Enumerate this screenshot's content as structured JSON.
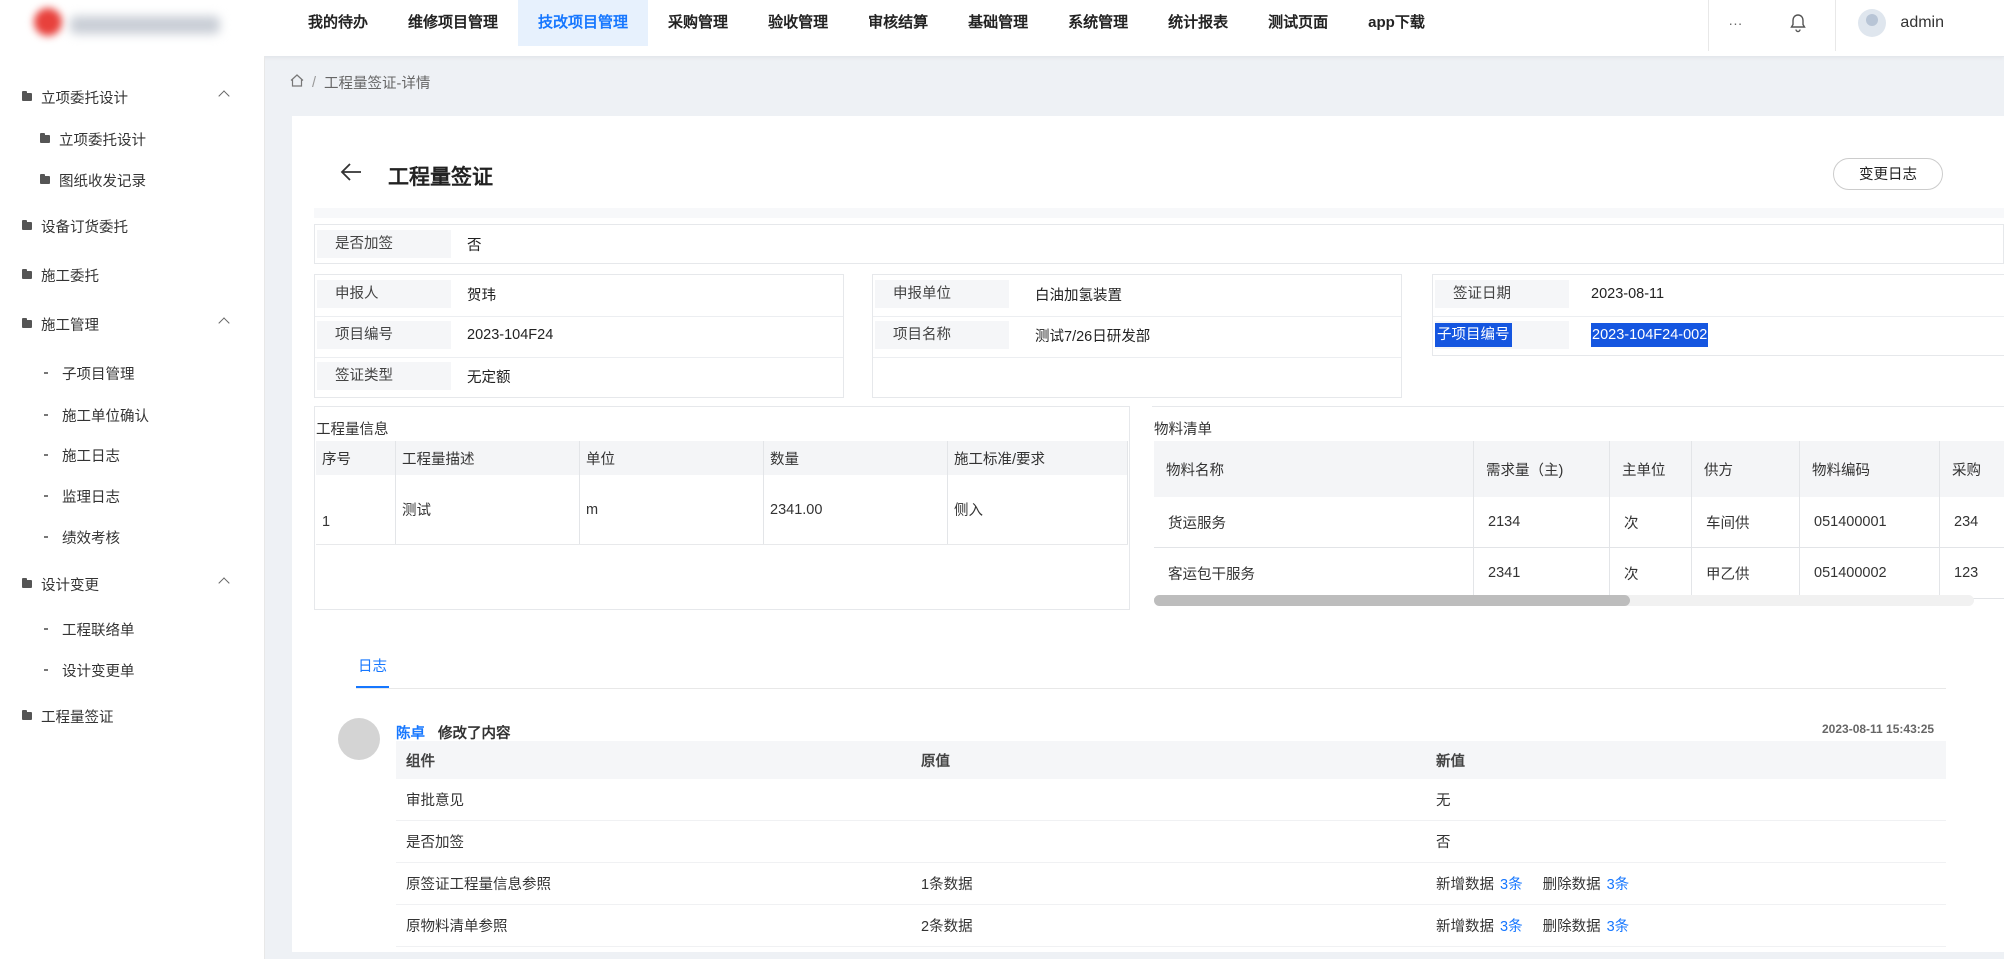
{
  "header": {
    "nav": [
      "我的待办",
      "维修项目管理",
      "技改项目管理",
      "采购管理",
      "验收管理",
      "审核结算",
      "基础管理",
      "系统管理",
      "统计报表",
      "测试页面",
      "app下载"
    ],
    "active_nav": "技改项目管理",
    "more": "···",
    "user": "admin"
  },
  "sidebar": {
    "items": [
      {
        "label": "立项委托设计",
        "level": 1,
        "expanded": true
      },
      {
        "label": "立项委托设计",
        "level": 2
      },
      {
        "label": "图纸收发记录",
        "level": 2
      },
      {
        "label": "设备订货委托",
        "level": 1
      },
      {
        "label": "施工委托",
        "level": 1
      },
      {
        "label": "施工管理",
        "level": 1,
        "expanded": true
      },
      {
        "label": "子项目管理",
        "level": 3
      },
      {
        "label": "施工单位确认",
        "level": 3
      },
      {
        "label": "施工日志",
        "level": 3
      },
      {
        "label": "监理日志",
        "level": 3
      },
      {
        "label": "绩效考核",
        "level": 3
      },
      {
        "label": "设计变更",
        "level": 1,
        "expanded": true
      },
      {
        "label": "工程联络单",
        "level": 3
      },
      {
        "label": "设计变更单",
        "level": 3
      },
      {
        "label": "工程量签证",
        "level": 1
      }
    ]
  },
  "breadcrumb": {
    "current": "工程量签证-详情"
  },
  "page": {
    "title": "工程量签证",
    "log_button": "变更日志"
  },
  "fields": {
    "is_add_sign": {
      "label": "是否加签",
      "value": "否"
    },
    "reporter": {
      "label": "申报人",
      "value": "贺玮"
    },
    "report_unit": {
      "label": "申报单位",
      "value": "白油加氢装置"
    },
    "sign_date": {
      "label": "签证日期",
      "value": "2023-08-11"
    },
    "project_no": {
      "label": "项目编号",
      "value": "2023-104F24"
    },
    "project_name": {
      "label": "项目名称",
      "value": "测试7/26日研发部"
    },
    "sub_project_no": {
      "label": "子项目编号",
      "value": "2023-104F24-002"
    },
    "sign_type": {
      "label": "签证类型",
      "value": "无定额"
    }
  },
  "quantity": {
    "title": "工程量信息",
    "headers": [
      "序号",
      "工程量描述",
      "单位",
      "数量",
      "施工标准/要求"
    ],
    "rows": [
      [
        "1",
        "测试",
        "m",
        "2341.00",
        "侧入"
      ]
    ]
  },
  "materials": {
    "title": "物料清单",
    "headers": [
      "物料名称",
      "需求量（主)",
      "主单位",
      "供方",
      "物料编码",
      "采购"
    ],
    "rows": [
      [
        "货运服务",
        "2134",
        "次",
        "车间供",
        "051400001",
        "234"
      ],
      [
        "客运包干服务",
        "2341",
        "次",
        "甲乙供",
        "051400002",
        "123"
      ]
    ]
  },
  "tabs": {
    "log": "日志"
  },
  "log": {
    "user": "陈卓",
    "action": "修改了内容",
    "time": "2023-08-11 15:43:25",
    "headers": [
      "组件",
      "原值",
      "新值"
    ],
    "rows": [
      {
        "component": "审批意见",
        "old": "",
        "new": "无"
      },
      {
        "component": "是否加签",
        "old": "",
        "new": "否"
      },
      {
        "component": "原签证工程量信息参照",
        "old": "1条数据",
        "add_label": "新增数据",
        "add_count": "3条",
        "del_label": "删除数据",
        "del_count": "3条"
      },
      {
        "component": "原物料清单参照",
        "old": "2条数据",
        "add_label": "新增数据",
        "add_count": "3条",
        "del_label": "删除数据",
        "del_count": "3条"
      }
    ]
  },
  "colors": {
    "accent": "#1677ff",
    "highlight": "#1556e0"
  }
}
